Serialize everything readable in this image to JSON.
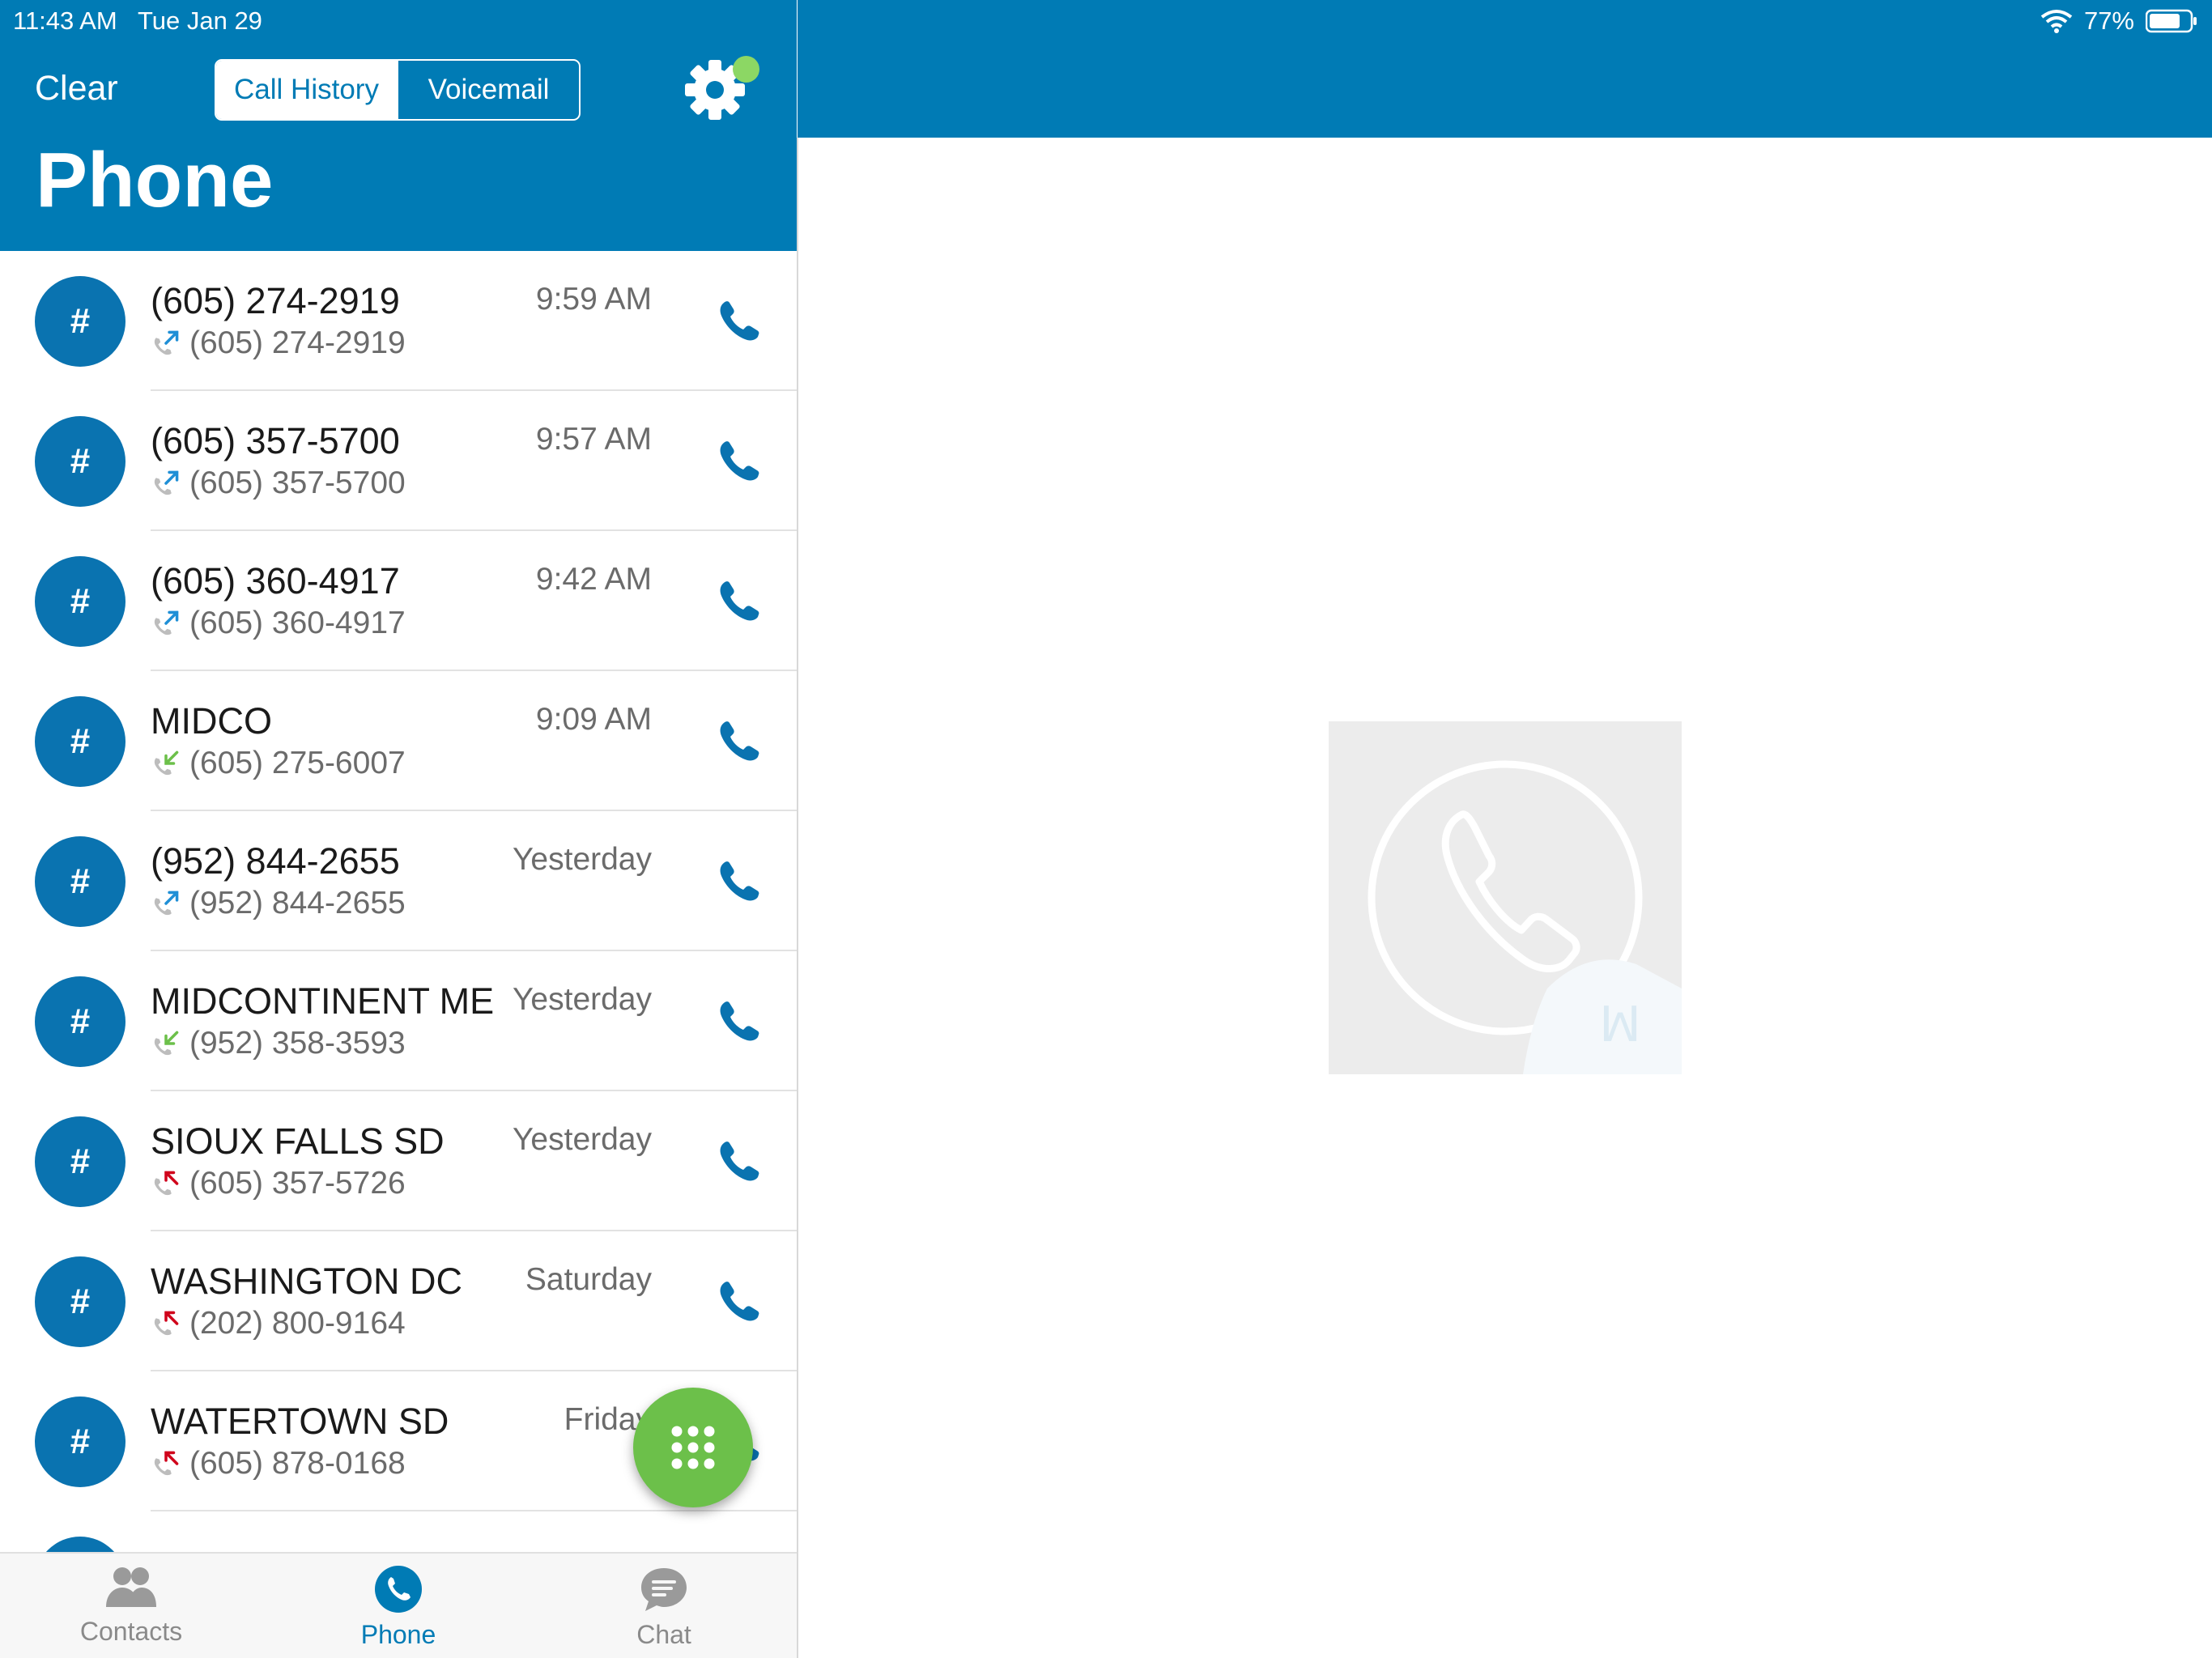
{
  "status_bar": {
    "time": "11:43 AM",
    "date": "Tue Jan 29",
    "battery": "77%",
    "battery_level": 0.77
  },
  "header": {
    "clear_label": "Clear",
    "segments": [
      "Call History",
      "Voicemail"
    ],
    "selected_segment": "Call History",
    "title": "Phone",
    "settings_icon": "gear-icon",
    "status_dot_color": "#8cd764"
  },
  "colors": {
    "brand": "#007bb5",
    "avatar": "#0a73b0",
    "fab": "#6cc04a",
    "outgoing": "#1f8fd6",
    "incoming": "#6cc04a",
    "missed": "#d0021b"
  },
  "calls": [
    {
      "avatar": "#",
      "name": "(605) 274-2919",
      "number": "(605) 274-2919",
      "time": "9:59 AM",
      "direction": "outgoing"
    },
    {
      "avatar": "#",
      "name": "(605) 357-5700",
      "number": "(605) 357-5700",
      "time": "9:57 AM",
      "direction": "outgoing"
    },
    {
      "avatar": "#",
      "name": "(605) 360-4917",
      "number": "(605) 360-4917",
      "time": "9:42 AM",
      "direction": "outgoing"
    },
    {
      "avatar": "#",
      "name": "MIDCO",
      "number": "(605) 275-6007",
      "time": "9:09 AM",
      "direction": "incoming"
    },
    {
      "avatar": "#",
      "name": "(952) 844-2655",
      "number": "(952) 844-2655",
      "time": "Yesterday",
      "direction": "outgoing"
    },
    {
      "avatar": "#",
      "name": "MIDCONTINENT ME",
      "number": "(952) 358-3593",
      "time": "Yesterday",
      "direction": "incoming"
    },
    {
      "avatar": "#",
      "name": "SIOUX FALLS SD",
      "number": "(605) 357-5726",
      "time": "Yesterday",
      "direction": "missed"
    },
    {
      "avatar": "#",
      "name": "WASHINGTON DC",
      "number": "(202) 800-9164",
      "time": "Saturday",
      "direction": "missed"
    },
    {
      "avatar": "#",
      "name": "WATERTOWN SD",
      "number": "(605) 878-0168",
      "time": "Friday",
      "direction": "missed"
    },
    {
      "avatar": "#",
      "name": "",
      "number": "",
      "time": "",
      "direction": "missed"
    }
  ],
  "fab": {
    "icon": "dialpad-icon"
  },
  "tabs": [
    {
      "label": "Contacts",
      "icon": "contacts-icon",
      "active": false
    },
    {
      "label": "Phone",
      "icon": "phone-icon",
      "active": true
    },
    {
      "label": "Chat",
      "icon": "chat-icon",
      "active": false
    }
  ],
  "detail_placeholder": {
    "icon": "phone-circle-icon"
  }
}
